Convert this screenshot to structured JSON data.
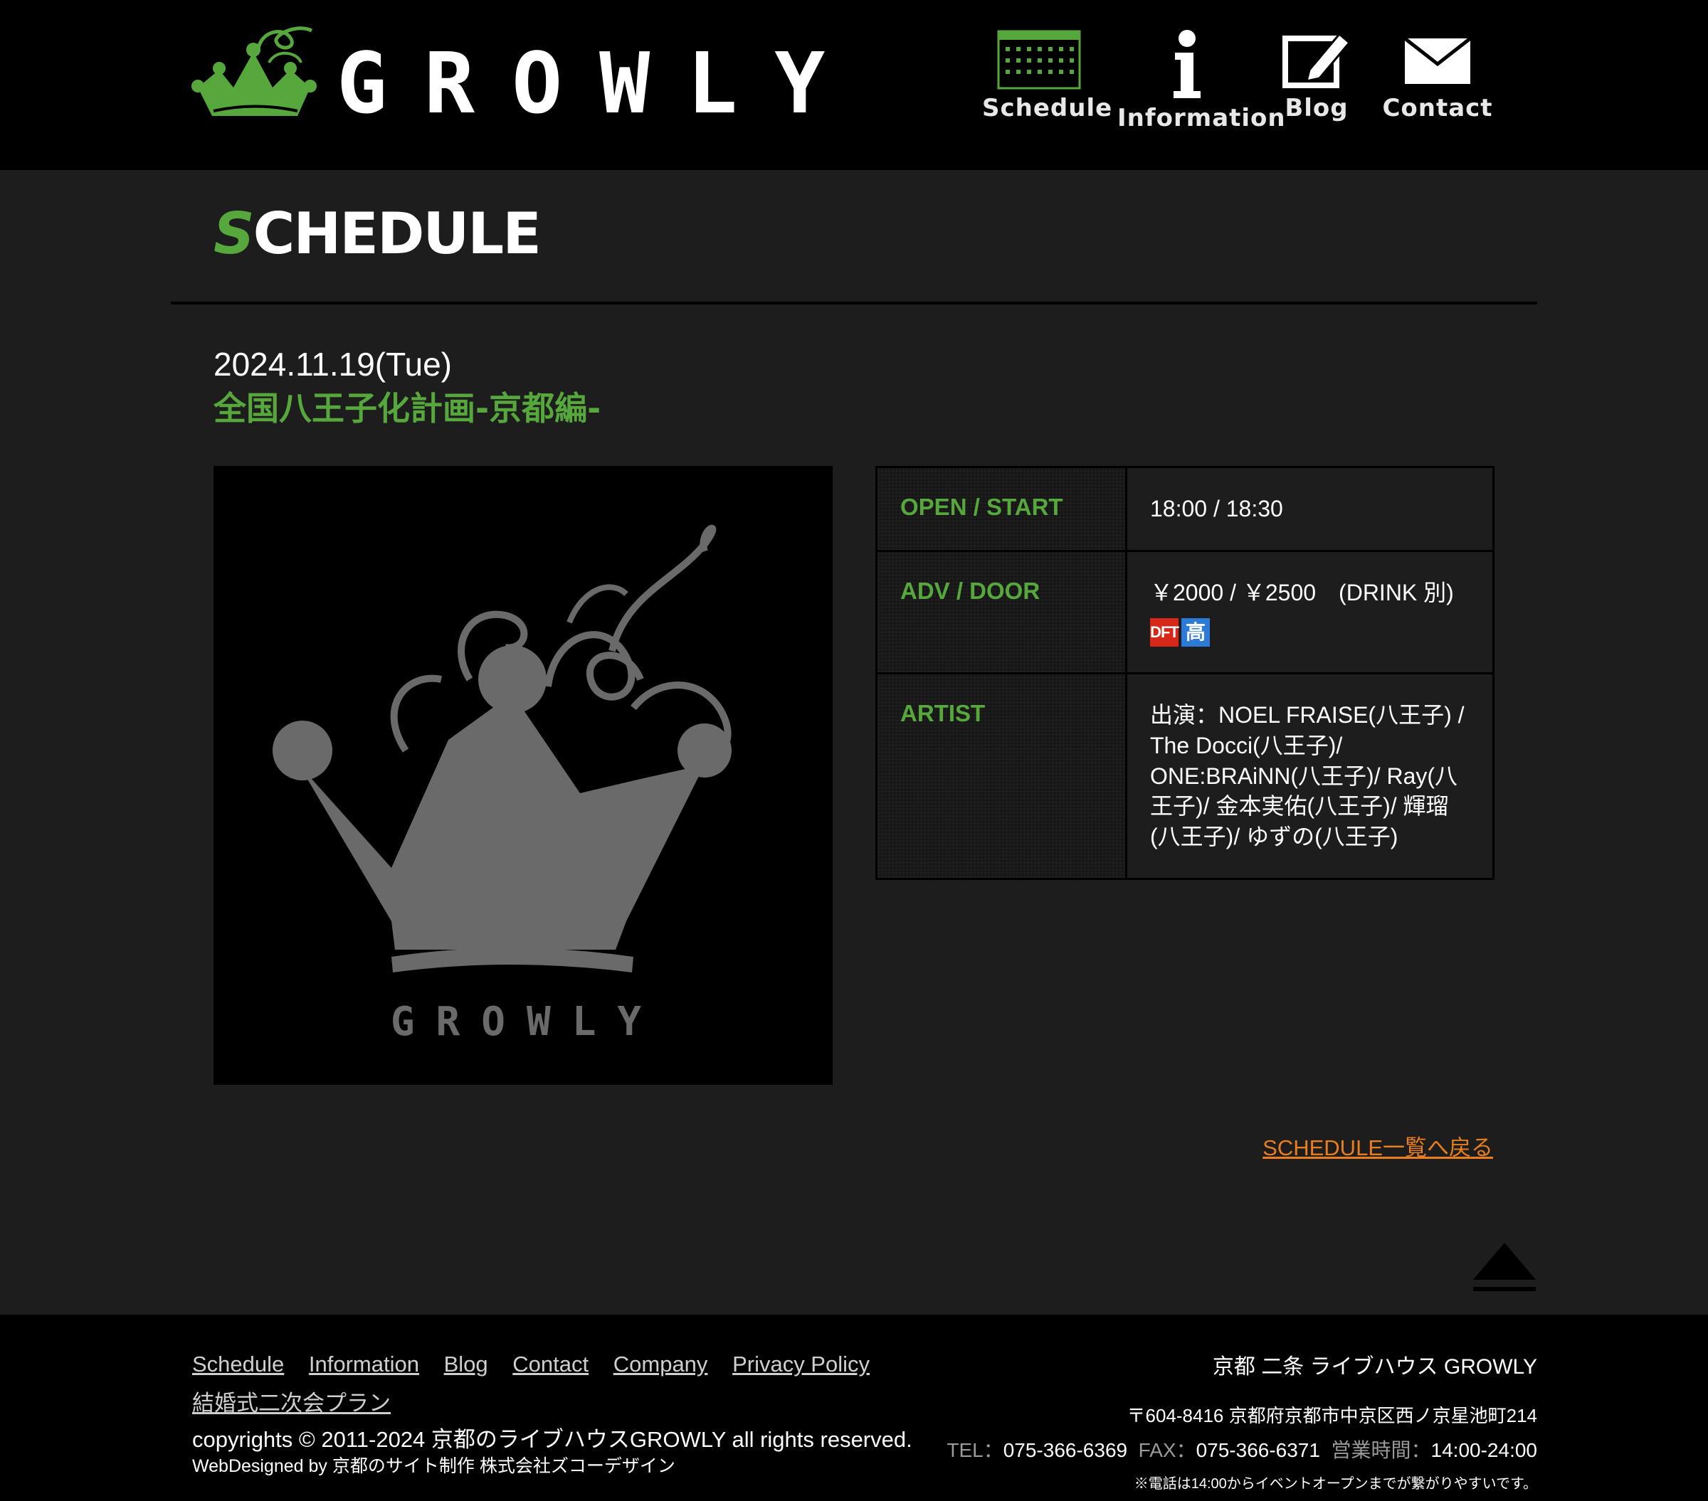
{
  "site": {
    "brand": "GROWLY",
    "accent_color": "#57a83c",
    "link_color": "#e87e1e"
  },
  "nav": [
    {
      "label": "Schedule",
      "icon": "calendar-icon"
    },
    {
      "label": "Information",
      "icon": "info-icon"
    },
    {
      "label": "Blog",
      "icon": "pencil-icon"
    },
    {
      "label": "Contact",
      "icon": "envelope-icon"
    }
  ],
  "page_title": {
    "initial": "S",
    "rest": "CHEDULE"
  },
  "event": {
    "date": "2024.11.19(Tue)",
    "title": "全国八王子化計画-京都編-",
    "flyer_text": "GROWLY",
    "rows": [
      {
        "label": "OPEN / START",
        "value": "18:00 / 18:30"
      },
      {
        "label": "ADV / DOOR",
        "value": "￥2000 / ￥2500　(DRINK 別)",
        "badges": [
          "DFT",
          "高"
        ]
      },
      {
        "label": "ARTIST",
        "value": "出演：NOEL FRAISE(八王子) / The Docci(八王子)/ ONE:BRAiNN(八王子)/ Ray(八王子)/ 金本実佑(八王子)/ 輝瑠(八王子)/ ゆずの(八王子)"
      }
    ]
  },
  "back_link": "SCHEDULE一覧へ戻る",
  "footer": {
    "links": [
      "Schedule",
      "Information",
      "Blog",
      "Contact",
      "Company",
      "Privacy Policy",
      "結婚式二次会プラン"
    ],
    "copyright": "copyrights © 2011-2024 京都のライブハウスGROWLY all rights reserved.",
    "webdesign": "WebDesigned by 京都のサイト制作 株式会社ズコーデザイン",
    "venue": "京都 二条 ライブハウス GROWLY",
    "address": "〒604-8416 京都府京都市中京区西ノ京星池町214",
    "tel_label": "TEL：",
    "tel": "075-366-6369",
    "fax_label": "FAX：",
    "fax": "075-366-6371",
    "hours_label": "営業時間：",
    "hours": "14:00-24:00",
    "note": "※電話は14:00からイベントオープンまでが繋がりやすいです。"
  }
}
